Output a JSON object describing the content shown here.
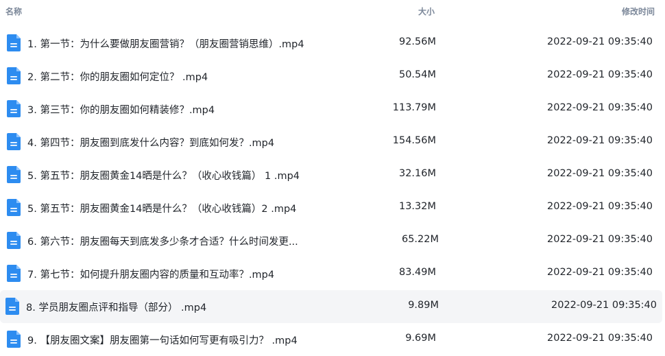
{
  "columns": {
    "name": "名称",
    "size": "大小",
    "modified": "修改时间"
  },
  "icon": "video-file-icon",
  "accent_color": "#2d8cf0",
  "files": [
    {
      "name": "1. 第一节：为什么要做朋友圈营销？（朋友圈营销思维）.mp4",
      "size": "92.56M",
      "modified": "2022-09-21 09:35:40"
    },
    {
      "name": "2. 第二节：你的朋友圈如何定位？ .mp4",
      "size": "50.54M",
      "modified": "2022-09-21 09:35:40"
    },
    {
      "name": "3. 第三节：你的朋友圈如何精装修？.mp4",
      "size": "113.79M",
      "modified": "2022-09-21 09:35:40"
    },
    {
      "name": "4. 第四节：朋友圈到底发什么内容？到底如何发？.mp4",
      "size": "154.56M",
      "modified": "2022-09-21 09:35:40"
    },
    {
      "name": "5. 第五节：朋友圈黄金14晒是什么？（收心收钱篇） 1 .mp4",
      "size": "32.16M",
      "modified": "2022-09-21 09:35:40"
    },
    {
      "name": "5. 第五节：朋友圈黄金14晒是什么？（收心收钱篇）2 .mp4",
      "size": "13.32M",
      "modified": "2022-09-21 09:35:40"
    },
    {
      "name": "6. 第六节：朋友圈每天到底发多少条才合适？什么时间发更...",
      "size": "65.22M",
      "modified": "2022-09-21 09:35:40"
    },
    {
      "name": "7. 第七节：如何提升朋友圈内容的质量和互动率？.mp4",
      "size": "83.49M",
      "modified": "2022-09-21 09:35:40"
    },
    {
      "name": "8. 学员朋友圈点评和指导（部分） .mp4",
      "size": "9.89M",
      "modified": "2022-09-21 09:35:40"
    },
    {
      "name": "9. 【朋友圈文案】朋友圈第一句话如何写更有吸引力？ .mp4",
      "size": "9.69M",
      "modified": "2022-09-21 09:35:40"
    }
  ]
}
